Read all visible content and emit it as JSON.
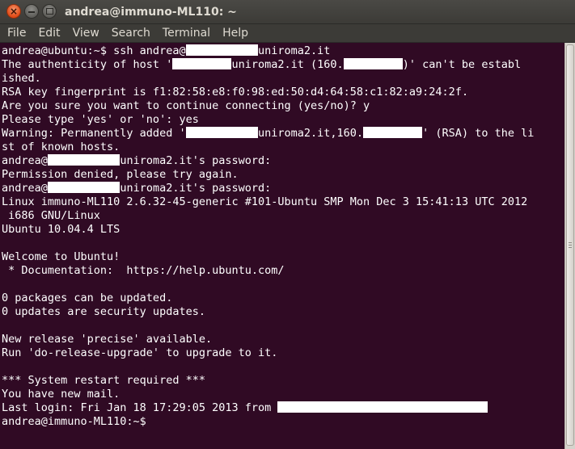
{
  "window": {
    "title": "andrea@immuno-ML110: ~",
    "close_glyph": "×",
    "min_glyph": "",
    "max_glyph": ""
  },
  "menu": {
    "items": [
      "File",
      "Edit",
      "View",
      "Search",
      "Terminal",
      "Help"
    ]
  },
  "terminal": {
    "lines": [
      [
        "andrea@ubuntu:~$ ssh andrea@",
        {
          "redact": 11
        },
        "uniroma2.it"
      ],
      [
        "The authenticity of host '",
        {
          "redact": 9
        },
        "uniroma2.it (160.",
        {
          "redact": 9
        },
        ")' can't be establ"
      ],
      [
        "ished."
      ],
      [
        "RSA key fingerprint is f1:82:58:e8:f0:98:ed:50:d4:64:58:c1:82:a9:24:2f."
      ],
      [
        "Are you sure you want to continue connecting (yes/no)? y"
      ],
      [
        "Please type 'yes' or 'no': yes"
      ],
      [
        "Warning: Permanently added '",
        {
          "redact": 11
        },
        "uniroma2.it,160.",
        {
          "redact": 9
        },
        "' (RSA) to the li"
      ],
      [
        "st of known hosts."
      ],
      [
        "andrea@",
        {
          "redact": 11
        },
        "uniroma2.it's password:"
      ],
      [
        "Permission denied, please try again."
      ],
      [
        "andrea@",
        {
          "redact": 11
        },
        "uniroma2.it's password:"
      ],
      [
        "Linux immuno-ML110 2.6.32-45-generic #101-Ubuntu SMP Mon Dec 3 15:41:13 UTC 2012"
      ],
      [
        " i686 GNU/Linux"
      ],
      [
        "Ubuntu 10.04.4 LTS"
      ],
      [
        ""
      ],
      [
        "Welcome to Ubuntu!"
      ],
      [
        " * Documentation:  https://help.ubuntu.com/"
      ],
      [
        ""
      ],
      [
        "0 packages can be updated."
      ],
      [
        "0 updates are security updates."
      ],
      [
        ""
      ],
      [
        "New release 'precise' available."
      ],
      [
        "Run 'do-release-upgrade' to upgrade to it."
      ],
      [
        ""
      ],
      [
        "*** System restart required ***"
      ],
      [
        "You have new mail."
      ],
      [
        "Last login: Fri Jan 18 17:29:05 2013 from ",
        {
          "redact": 32
        }
      ],
      [
        "andrea@immuno-ML110:~$"
      ]
    ]
  },
  "colors": {
    "terminal_bg": "#300a24",
    "terminal_fg": "#ffffff",
    "titlebar_bg": "#3c3b37",
    "close_button": "#df4a16"
  },
  "icons": {
    "close": "close-icon",
    "minimize": "minimize-icon",
    "maximize": "maximize-icon"
  }
}
